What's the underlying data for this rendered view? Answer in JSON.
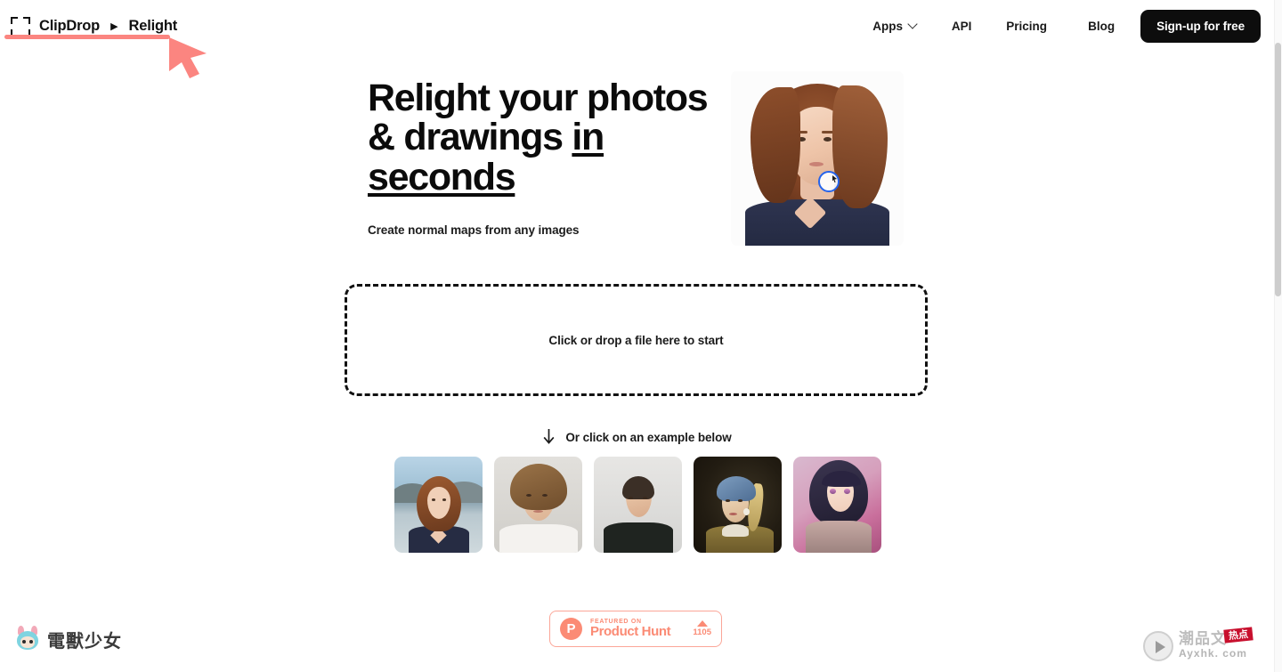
{
  "header": {
    "logo_icon": "clipdrop-frame-icon",
    "brand": "ClipDrop",
    "separator": "▶",
    "current_page": "Relight",
    "nav": [
      {
        "label": "Apps",
        "has_chevron": true,
        "icon": "chevron-down-icon"
      },
      {
        "label": "API",
        "has_chevron": false
      },
      {
        "label": "Pricing",
        "has_chevron": false
      },
      {
        "label": "Blog",
        "has_chevron": false
      }
    ],
    "signup_label": "Sign-up for free"
  },
  "annotation": {
    "color": "#fb8580",
    "cursor_icon": "cursor-arrow-icon"
  },
  "hero": {
    "headline_part1": "Relight your photos & drawings ",
    "headline_underlined": "in seconds",
    "subtitle": "Create normal maps from any images",
    "photo_alt": "woman with auburn bob haircut on white background",
    "light_control_icon": "light-position-handle-icon",
    "light_control_color": "#2563eb"
  },
  "dropzone": {
    "label": "Click or drop a file here to start"
  },
  "examples": {
    "hint_icon": "down-arrow-icon",
    "hint_text": "Or click on an example below",
    "items": [
      {
        "name": "example-woman-auburn-bob"
      },
      {
        "name": "example-curly-haired-man"
      },
      {
        "name": "example-young-man-black-shirt"
      },
      {
        "name": "example-girl-with-pearl-earring"
      },
      {
        "name": "example-anime-girl"
      }
    ]
  },
  "product_hunt": {
    "logo_letter": "P",
    "featured_on": "FEATURED ON",
    "name": "Product Hunt",
    "upvote_icon": "upvote-triangle-icon",
    "count": "1105",
    "color": "#fb8b75"
  },
  "watermarks": {
    "left": {
      "text": "電獸少女",
      "icon": "mascot-avatar-icon"
    },
    "right": {
      "play_icon": "play-button-icon",
      "text": "潮品文",
      "stamp": "热点",
      "url": "Ayxhk. com"
    }
  },
  "scrollbar": {
    "name": "vertical-scrollbar"
  }
}
